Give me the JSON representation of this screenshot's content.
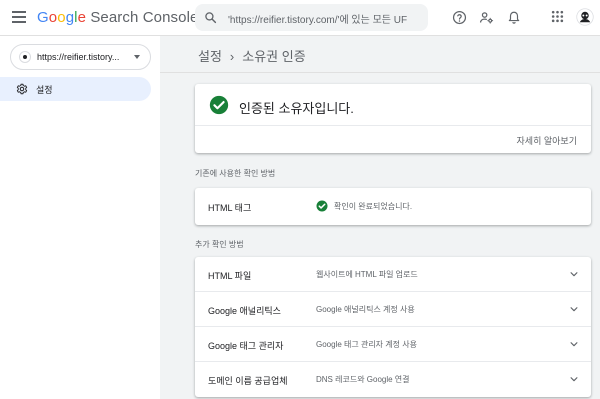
{
  "header": {
    "logo_google": [
      "G",
      "o",
      "o",
      "g",
      "l",
      "e"
    ],
    "logo_product": "Search Console",
    "search_placeholder": "'https://reifier.tistory.com/'에 있는 모든 UF",
    "icons": [
      "menu-icon",
      "search-icon",
      "help-icon",
      "manage-users-icon",
      "notifications-icon",
      "apps-icon",
      "account-avatar-icon"
    ]
  },
  "sidebar": {
    "property": "https://reifier.tistory...",
    "items": [
      {
        "label": "설정",
        "icon": "gear-icon",
        "selected": true
      }
    ]
  },
  "breadcrumb": {
    "parent": "설정",
    "separator": "›",
    "current": "소유권 인증"
  },
  "verified": {
    "title": "인증된 소유자입니다.",
    "learn_more": "자세히 알아보기"
  },
  "legacy": {
    "section_label": "기존에 사용한 확인 방법",
    "method": "HTML 태그",
    "status": "확인이 완료되었습니다."
  },
  "extra": {
    "section_label": "추가 확인 방법",
    "methods": [
      {
        "name": "HTML 파일",
        "desc": "웹사이트에 HTML 파일 업로드"
      },
      {
        "name": "Google 애널리틱스",
        "desc": "Google 애널리틱스 계정 사용"
      },
      {
        "name": "Google 태그 관리자",
        "desc": "Google 태그 관리자 계정 사용"
      },
      {
        "name": "도메인 이름 공급업체",
        "desc": "DNS 레코드와 Google 연결"
      }
    ]
  },
  "colors": {
    "accent": "#1a73e8",
    "success": "#188038",
    "nav_selected_bg": "#e8f0fe"
  }
}
